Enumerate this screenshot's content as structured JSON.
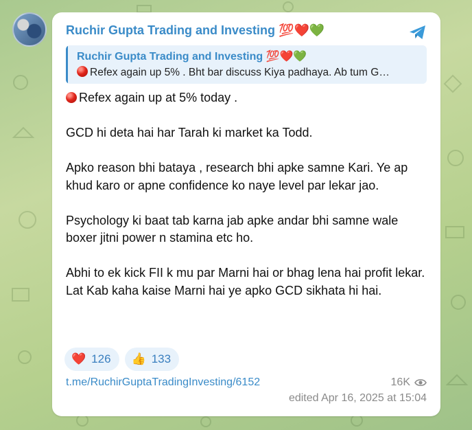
{
  "post": {
    "channel_name": "Ruchir Gupta Trading and Investing 💯❤️💚",
    "reply": {
      "author": "Ruchir Gupta Trading and Investing 💯❤️💚",
      "text": "Refex again up 5% . Bht bar discuss Kiya padhaya. Ab tum G…"
    },
    "paragraphs": {
      "p1": "Refex again up at 5% today .",
      "p2": "GCD hi deta hai har Tarah ki market ka Todd.",
      "p3": "Apko reason bhi bataya , research bhi apke samne Kari. Ye ap khud karo or apne confidence ko naye level par lekar jao.",
      "p4": "Psychology ki baat tab karna jab apke andar bhi samne wale boxer jitni power n stamina etc ho.",
      "p5": "Abhi to ek kick FII k mu par Marni hai or bhag lena hai profit lekar. Lat Kab kaha kaise Marni hai ye apko GCD sikhata hi hai."
    },
    "reactions": [
      {
        "emoji": "❤️",
        "count": "126"
      },
      {
        "emoji": "👍",
        "count": "133"
      }
    ],
    "link": "t.me/RuchirGuptaTradingInvesting/6152",
    "views": "16K",
    "edited": "edited  Apr 16, 2025 at 15:04"
  },
  "icons": {
    "share": "telegram-share-icon",
    "views": "eye-icon",
    "bullet": "red-circle-icon"
  },
  "colors": {
    "accent": "#3a8bc8",
    "reply_bg": "#e8f2fb",
    "meta": "#8a8a8a"
  }
}
